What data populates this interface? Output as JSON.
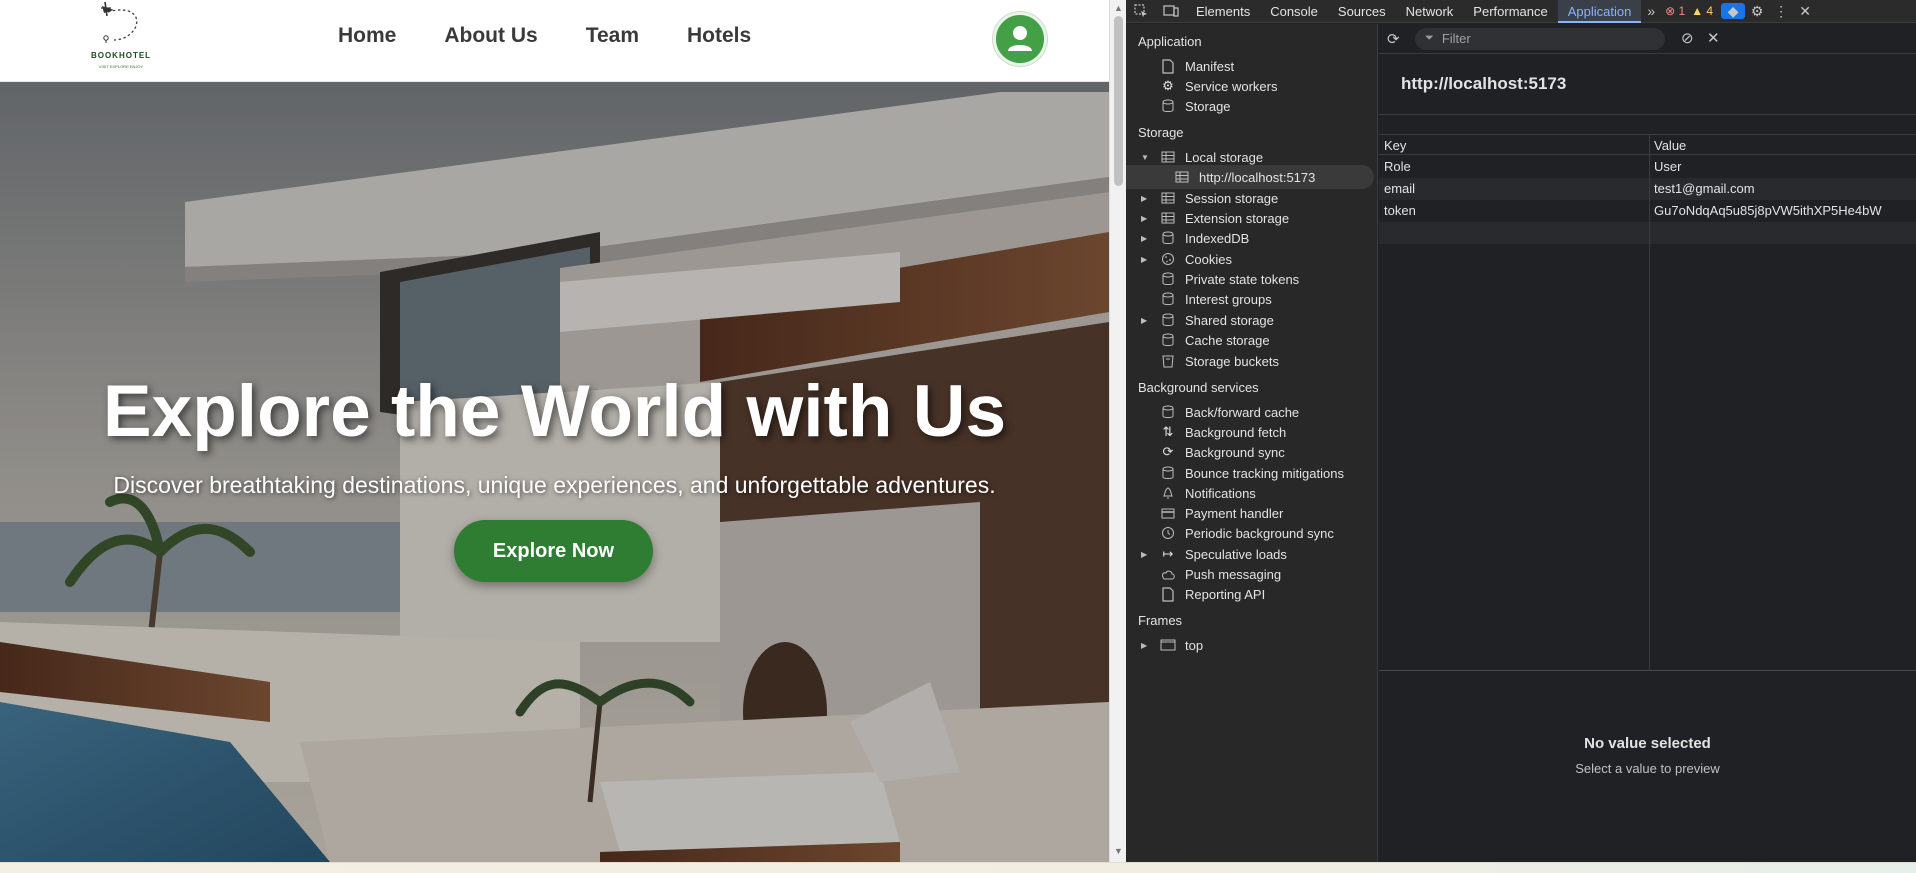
{
  "site": {
    "logo": {
      "brand": "BOOKHOTEL",
      "tagline": "VISIT EXPLORE ENJOY"
    },
    "nav": [
      "Home",
      "About Us",
      "Team",
      "Hotels"
    ],
    "hero": {
      "title": "Explore the World with Us",
      "subtitle": "Discover breathtaking destinations, unique experiences, and unforgettable adventures.",
      "cta": "Explore Now"
    },
    "colors": {
      "accent": "#2e7d32",
      "avatar": "#43a047"
    }
  },
  "devtools": {
    "tabs": [
      "Elements",
      "Console",
      "Sources",
      "Network",
      "Performance",
      "Application"
    ],
    "active_tab": "Application",
    "error_count": "1",
    "warning_count": "4",
    "sidebar": {
      "application_label": "Application",
      "application_items": [
        "Manifest",
        "Service workers",
        "Storage"
      ],
      "storage_label": "Storage",
      "storage_items": [
        "Local storage",
        "http://localhost:5173",
        "Session storage",
        "Extension storage",
        "IndexedDB",
        "Cookies",
        "Private state tokens",
        "Interest groups",
        "Shared storage",
        "Cache storage",
        "Storage buckets"
      ],
      "background_label": "Background services",
      "background_items": [
        "Back/forward cache",
        "Background fetch",
        "Background sync",
        "Bounce tracking mitigations",
        "Notifications",
        "Payment handler",
        "Periodic background sync",
        "Speculative loads",
        "Push messaging",
        "Reporting API"
      ],
      "frames_label": "Frames",
      "frames_items": [
        "top"
      ]
    },
    "main": {
      "filter_placeholder": "Filter",
      "origin": "http://localhost:5173",
      "columns": [
        "Key",
        "Value"
      ],
      "rows": [
        {
          "key": "Role",
          "value": "User"
        },
        {
          "key": "email",
          "value": "test1@gmail.com"
        },
        {
          "key": "token",
          "value": "Gu7oNdqAq5u85j8pVW5ithXP5He4bW"
        }
      ],
      "no_value_title": "No value selected",
      "no_value_sub": "Select a value to preview"
    }
  }
}
